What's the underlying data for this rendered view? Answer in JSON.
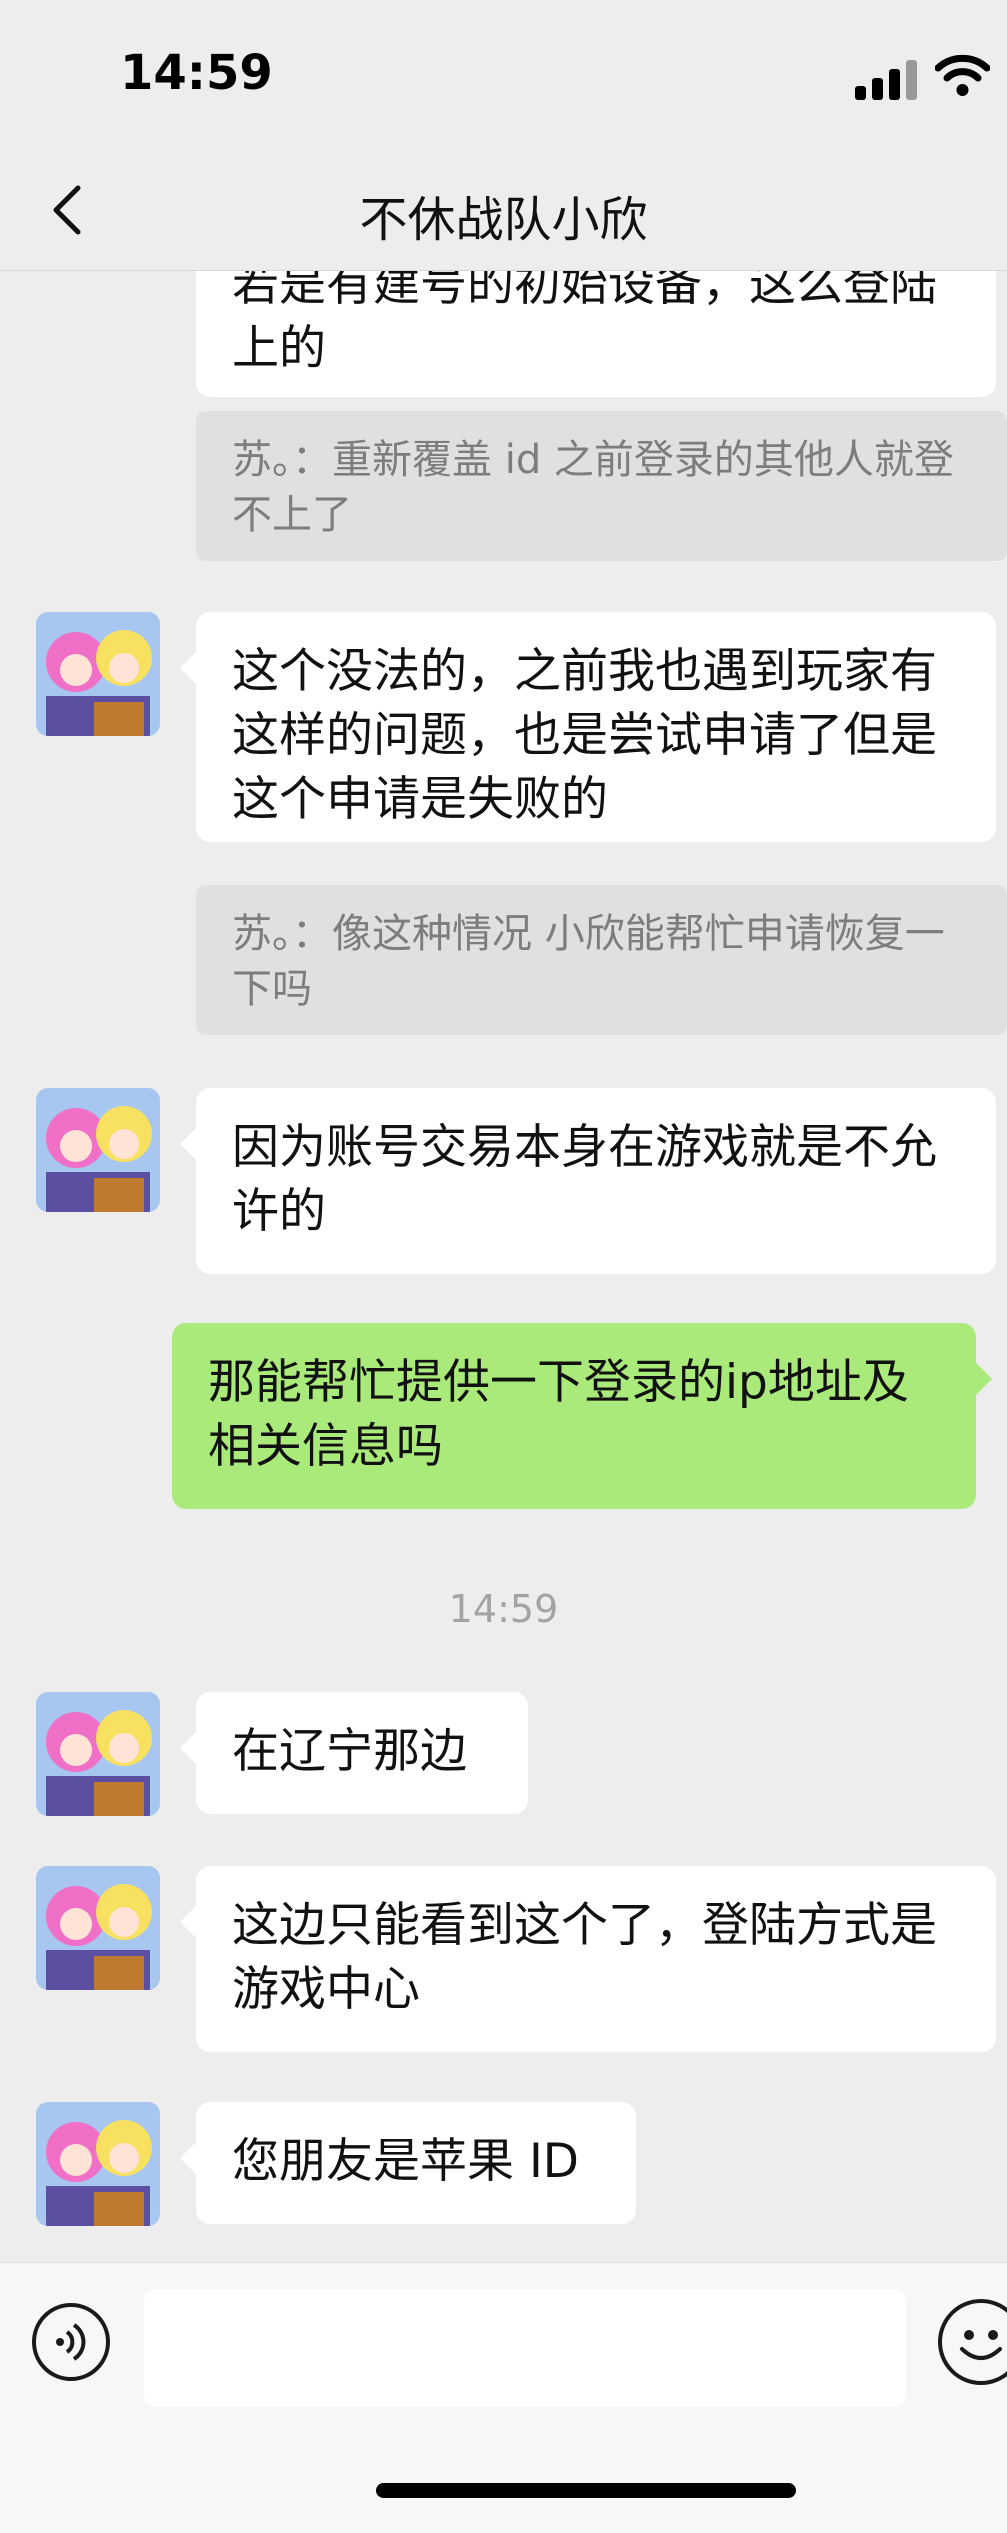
{
  "status": {
    "time": "14:59"
  },
  "header": {
    "title": "不休战队小欣"
  },
  "messages": [
    {
      "id": "m0",
      "text": "若是有建号的初始设备，这么登陆上的"
    },
    {
      "id": "q0",
      "text": "苏。：重新覆盖 id 之前登录的其他人就登不上了"
    },
    {
      "id": "m1",
      "text": "这个没法的，之前我也遇到玩家有这样的问题，也是尝试申请了但是这个申请是失败的"
    },
    {
      "id": "q1",
      "text": "苏。：像这种情况 小欣能帮忙申请恢复一下吗"
    },
    {
      "id": "m2",
      "text": "因为账号交易本身在游戏就是不允许的"
    },
    {
      "id": "m3",
      "text": "那能帮忙提供一下登录的ip地址及相关信息吗"
    },
    {
      "id": "ts",
      "text": "14:59"
    },
    {
      "id": "m4",
      "text": "在辽宁那边"
    },
    {
      "id": "m5",
      "text": "这边只能看到这个了，登陆方式是游戏中心"
    },
    {
      "id": "m6",
      "text": "您朋友是苹果 ID"
    }
  ],
  "colors": {
    "background": "#ededed",
    "sent_bubble": "#a9ea7a",
    "received_bubble": "#ffffff",
    "quote_bg": "#e0e0e0"
  },
  "icons": [
    "back-chevron-icon",
    "signal-icon",
    "wifi-icon",
    "voice-icon",
    "emoji-icon",
    "avatar"
  ]
}
